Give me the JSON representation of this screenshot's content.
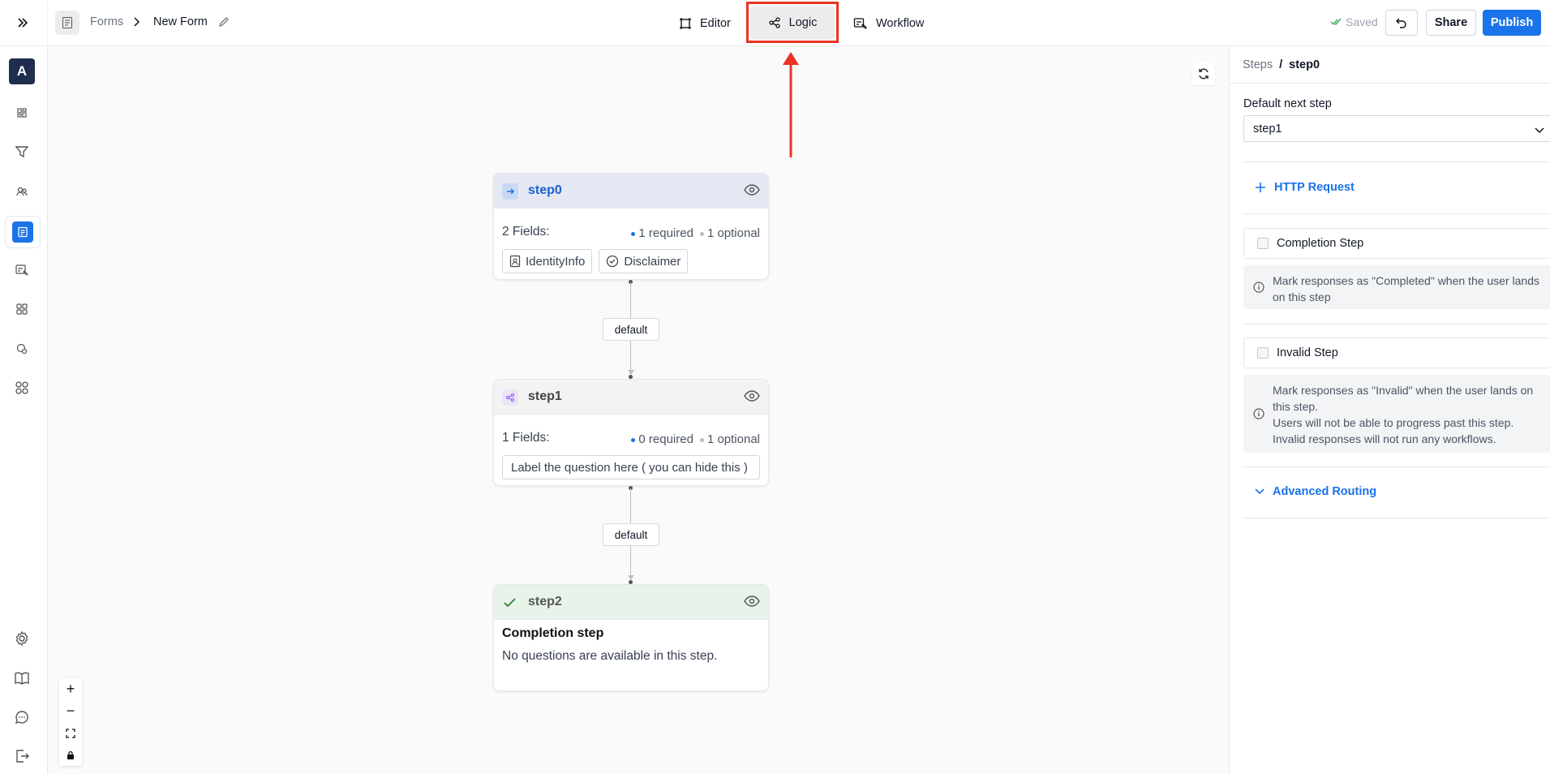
{
  "header": {
    "breadcrumb_root": "Forms",
    "breadcrumb_current": "New Form",
    "tabs": [
      {
        "label": "Editor"
      },
      {
        "label": "Logic"
      },
      {
        "label": "Workflow"
      }
    ],
    "active_tab": "Logic",
    "saved_status": "Saved",
    "share_label": "Share",
    "publish_label": "Publish"
  },
  "sidebar": {
    "avatar_letter": "A",
    "icons": [
      "dashboard-icon",
      "filter-icon",
      "users-icon",
      "forms-icon",
      "submissions-icon",
      "apps-icon",
      "integrations-icon",
      "modules-icon",
      "settings-icon",
      "docs-icon",
      "chat-icon",
      "logout-icon"
    ]
  },
  "canvas": {
    "nodes": [
      {
        "id": "step0",
        "title": "step0",
        "fields_label": "2 Fields:",
        "required": "1 required",
        "optional": "1 optional",
        "chips": [
          "IdentityInfo",
          "Disclaimer"
        ]
      },
      {
        "id": "step1",
        "title": "step1",
        "fields_label": "1 Fields:",
        "required": "0 required",
        "optional": "1 optional",
        "chips": [
          "Label the question here ( you can hide this )"
        ]
      },
      {
        "id": "step2",
        "title": "step2",
        "completion_title": "Completion step",
        "completion_text": "No questions are available in this step."
      }
    ],
    "edges": [
      {
        "label": "default"
      },
      {
        "label": "default"
      }
    ],
    "zoom_controls": {
      "zoom_in": "+",
      "zoom_out": "−"
    }
  },
  "right_panel": {
    "crumb_root": "Steps",
    "crumb_sep": "/",
    "crumb_current": "step0",
    "default_next_label": "Default next step",
    "default_next_value": "step1",
    "http_request_label": "HTTP Request",
    "completion_step_label": "Completion Step",
    "completion_info": "Mark responses as \"Completed\" when the user lands on this step",
    "invalid_step_label": "Invalid Step",
    "invalid_info_1": "Mark responses as \"Invalid\" when the user lands on this step.",
    "invalid_info_2": "Users will not be able to progress past this step.",
    "invalid_info_3": "Invalid responses will not run any workflows.",
    "advanced_routing_label": "Advanced Routing"
  },
  "colors": {
    "accent": "#1a73e8",
    "highlight": "#ea3323",
    "step0_header": "#e3e8f3",
    "step1_header": "#f3f3f3",
    "step2_header": "#e8f4ea"
  }
}
